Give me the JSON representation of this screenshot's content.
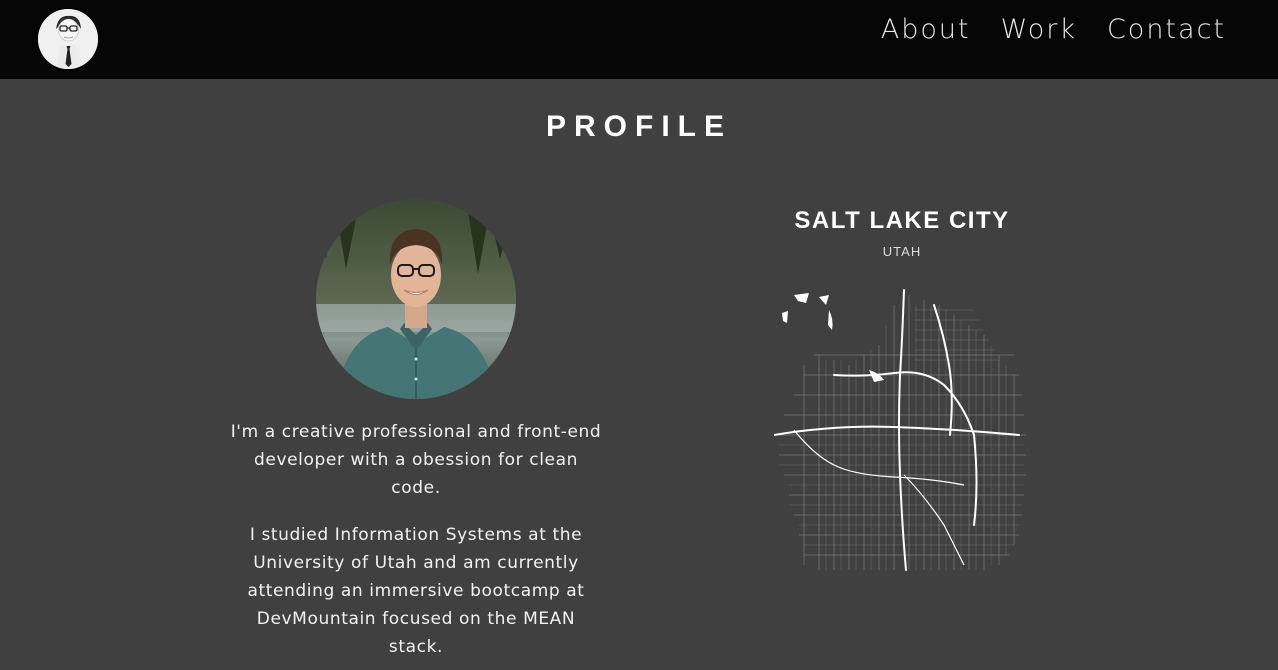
{
  "nav": {
    "links": [
      "About",
      "Work",
      "Contact"
    ]
  },
  "profile": {
    "title": "PROFILE",
    "bio_paragraphs": [
      "I'm a creative professional and front-end developer with a obession for clean code.",
      "I studied Information Systems at the University of Utah and am currently attending an immersive bootcamp at DevMountain focused on the MEAN stack."
    ]
  },
  "map": {
    "title": "SALT LAKE CITY",
    "subtitle": "UTAH"
  }
}
